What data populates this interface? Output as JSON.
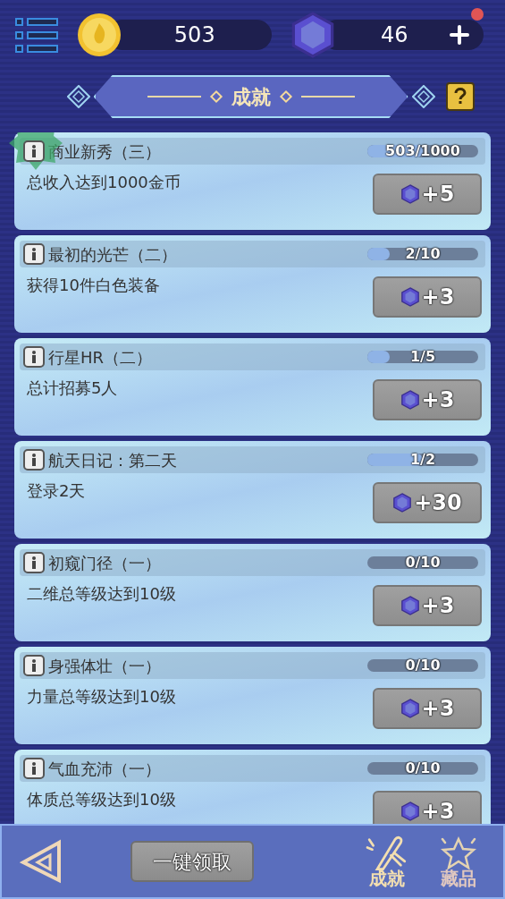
{
  "currencies": [
    {
      "kind": "coin",
      "amount": "503",
      "plus": false,
      "alert": false
    },
    {
      "kind": "gem",
      "amount": "46",
      "plus": true,
      "alert": true
    }
  ],
  "title": "成就",
  "achievements": [
    {
      "name": "商业新秀（三）",
      "progress": "503/1000",
      "level": 0.503,
      "description": "总收入达到1000金币",
      "reward": "+5",
      "badge": true
    },
    {
      "name": "最初的光芒（二）",
      "progress": "2/10",
      "level": 0.2,
      "description": "获得10件白色装备",
      "reward": "+3",
      "badge": false
    },
    {
      "name": "行星HR（二）",
      "progress": "1/5",
      "level": 0.2,
      "description": "总计招募5人",
      "reward": "+3",
      "badge": false
    },
    {
      "name": "航天日记：第二天",
      "progress": "1/2",
      "level": 0.5,
      "description": "登录2天",
      "reward": "+30",
      "badge": false
    },
    {
      "name": "初窥门径（一）",
      "progress": "0/10",
      "level": 0,
      "description": "二维总等级达到10级",
      "reward": "+3",
      "badge": false
    },
    {
      "name": "身强体壮（一）",
      "progress": "0/10",
      "level": 0,
      "description": "力量总等级达到10级",
      "reward": "+3",
      "badge": false
    },
    {
      "name": "气血充沛（一）",
      "progress": "0/10",
      "level": 0,
      "description": "体质总等级达到10级",
      "reward": "+3",
      "badge": false
    }
  ],
  "bottom_bar": {
    "claim_all": "一键领取",
    "tabs": [
      {
        "kind": "scroll",
        "label": "成就",
        "selected": true
      },
      {
        "kind": "star",
        "label": "藏品",
        "selected": false
      }
    ]
  }
}
